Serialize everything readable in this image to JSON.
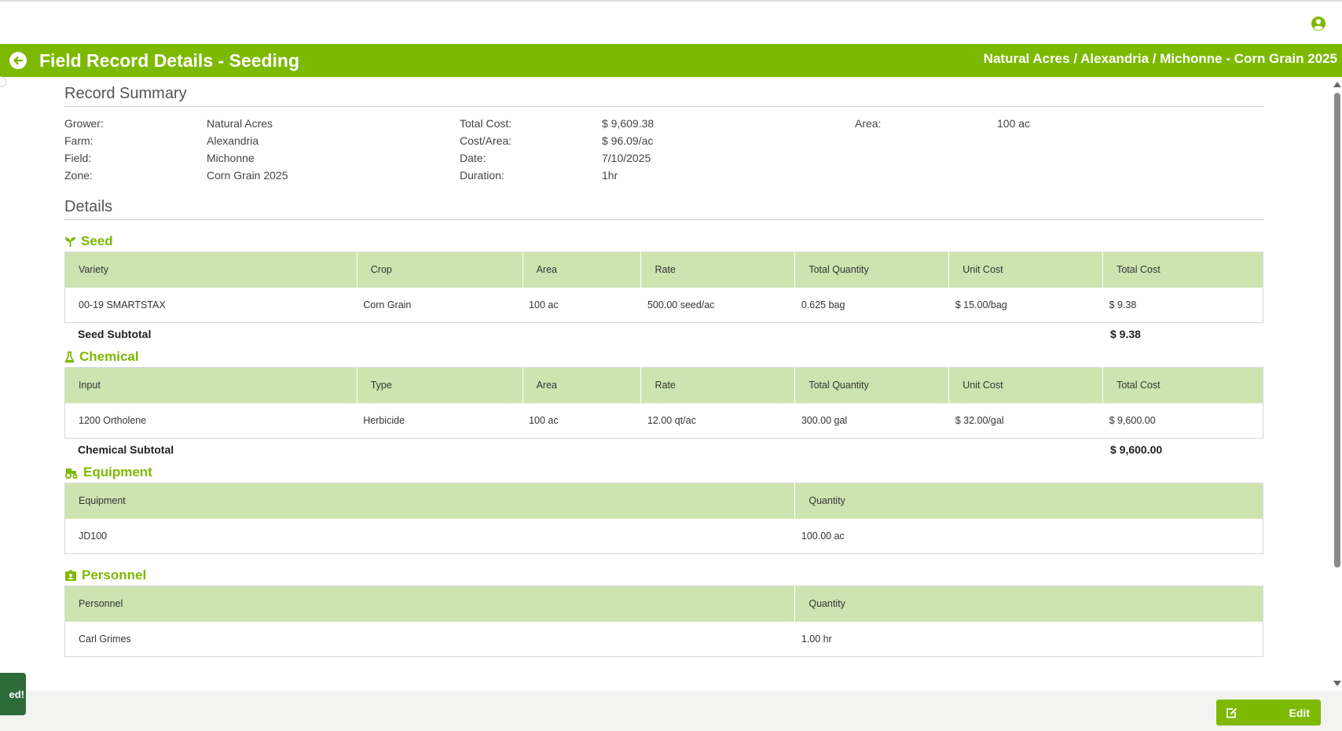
{
  "header": {
    "title": "Field Record Details - Seeding",
    "breadcrumb": "Natural Acres / Alexandria / Michonne - Corn Grain 2025"
  },
  "summary": {
    "title": "Record Summary",
    "rows": [
      [
        {
          "label": "Grower:",
          "value": "Natural Acres"
        },
        {
          "label": "Total Cost:",
          "value": "$ 9,609.38"
        },
        {
          "label": "Area:",
          "value": "100 ac"
        }
      ],
      [
        {
          "label": "Farm:",
          "value": "Alexandria"
        },
        {
          "label": "Cost/Area:",
          "value": "$ 96.09/ac"
        },
        {
          "label": "",
          "value": ""
        }
      ],
      [
        {
          "label": "Field:",
          "value": "Michonne"
        },
        {
          "label": "Date:",
          "value": "7/10/2025"
        },
        {
          "label": "",
          "value": ""
        }
      ],
      [
        {
          "label": "Zone:",
          "value": "Corn Grain 2025"
        },
        {
          "label": "Duration:",
          "value": "1hr"
        },
        {
          "label": "",
          "value": ""
        }
      ]
    ]
  },
  "details": {
    "title": "Details",
    "seed": {
      "heading": "Seed",
      "columns": [
        "Variety",
        "Crop",
        "Area",
        "Rate",
        "Total Quantity",
        "Unit Cost",
        "Total Cost"
      ],
      "rows": [
        [
          "00-19 SMARTSTAX",
          "Corn Grain",
          "100 ac",
          "500.00 seed/ac",
          "0.625 bag",
          "$ 15.00/bag",
          "$ 9.38"
        ]
      ],
      "subtotal_label": "Seed Subtotal",
      "subtotal_value": "$ 9.38"
    },
    "chemical": {
      "heading": "Chemical",
      "columns": [
        "Input",
        "Type",
        "Area",
        "Rate",
        "Total Quantity",
        "Unit Cost",
        "Total Cost"
      ],
      "rows": [
        [
          "1200 Ortholene",
          "Herbicide",
          "100 ac",
          "12.00 qt/ac",
          "300.00 gal",
          "$ 32.00/gal",
          "$ 9,600.00"
        ]
      ],
      "subtotal_label": "Chemical Subtotal",
      "subtotal_value": "$ 9,600.00"
    },
    "equipment": {
      "heading": "Equipment",
      "columns": [
        "Equipment",
        "Quantity"
      ],
      "rows": [
        [
          "JD100",
          "100.00 ac"
        ]
      ]
    },
    "personnel": {
      "heading": "Personnel",
      "columns": [
        "Personnel",
        "Quantity"
      ],
      "rows": [
        [
          "Carl Grimes",
          "1.00 hr"
        ]
      ]
    }
  },
  "toast": {
    "text": "ed!"
  },
  "footer": {
    "edit_label": "Edit"
  },
  "colors": {
    "brand": "#7cb900",
    "table_header": "#cde4b0",
    "toast": "#2e6b3a"
  },
  "icons": {
    "user": "user-circle-icon",
    "back": "arrow-left-circle-icon",
    "seed": "seedling-icon",
    "chemical": "flask-icon",
    "equipment": "tractor-icon",
    "personnel": "id-badge-icon",
    "edit": "edit-icon"
  }
}
